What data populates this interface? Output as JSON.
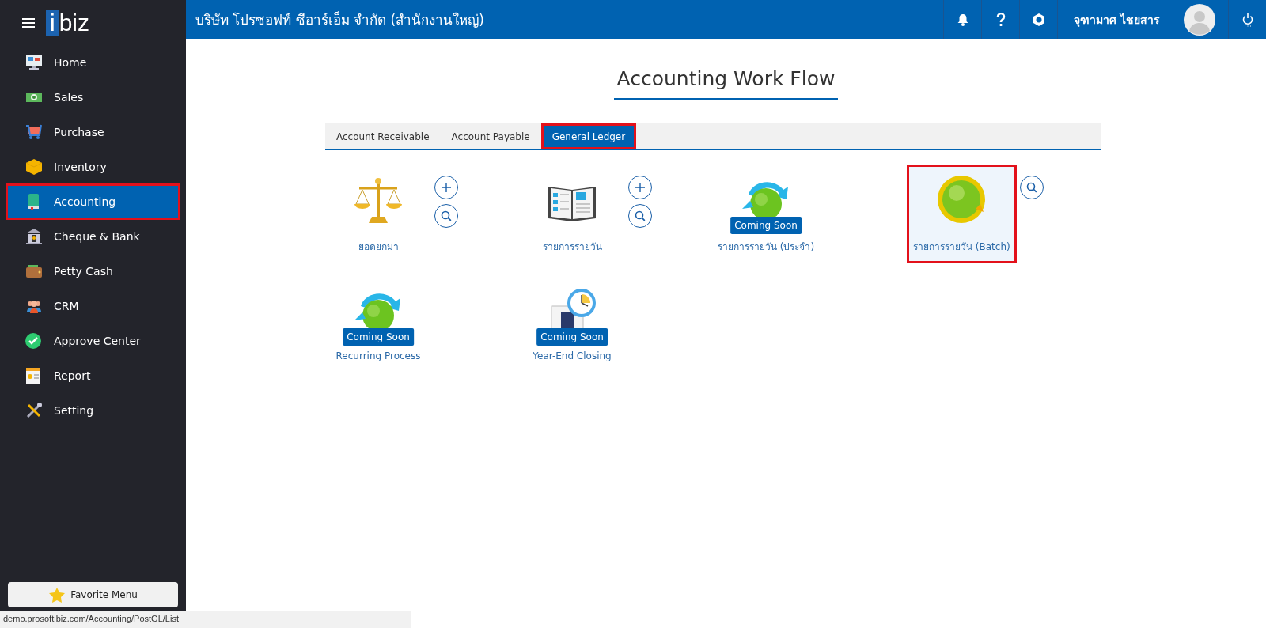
{
  "topbar": {
    "company": "บริษัท โปรซอฟท์ ซีอาร์เอ็ม จำกัด (สำนักงานใหญ่)",
    "user_name": "จุฑามาศ ไชยสาร"
  },
  "sidebar": {
    "logo_prefix": "i",
    "logo_rest": "biz",
    "items": [
      {
        "label": "Home",
        "selected": false,
        "highlighted": false
      },
      {
        "label": "Sales",
        "selected": false,
        "highlighted": false
      },
      {
        "label": "Purchase",
        "selected": false,
        "highlighted": false
      },
      {
        "label": "Inventory",
        "selected": false,
        "highlighted": false
      },
      {
        "label": "Accounting",
        "selected": true,
        "highlighted": true
      },
      {
        "label": "Cheque & Bank",
        "selected": false,
        "highlighted": false
      },
      {
        "label": "Petty Cash",
        "selected": false,
        "highlighted": false
      },
      {
        "label": "CRM",
        "selected": false,
        "highlighted": false
      },
      {
        "label": "Approve Center",
        "selected": false,
        "highlighted": false
      },
      {
        "label": "Report",
        "selected": false,
        "highlighted": false
      },
      {
        "label": "Setting",
        "selected": false,
        "highlighted": false
      }
    ],
    "favorite_button": "Favorite Menu"
  },
  "page": {
    "title": "Accounting Work Flow"
  },
  "tabs": [
    {
      "label": "Account Receivable",
      "selected": false,
      "highlighted": false
    },
    {
      "label": "Account Payable",
      "selected": false,
      "highlighted": false
    },
    {
      "label": "General Ledger",
      "selected": true,
      "highlighted": true
    }
  ],
  "workflow_items": [
    {
      "label": "ยอดยกมา",
      "coming_soon": false,
      "add_button": true,
      "search_button": true,
      "highlighted": false
    },
    {
      "label": "รายการรายวัน",
      "coming_soon": false,
      "add_button": true,
      "search_button": true,
      "highlighted": false
    },
    {
      "label": "รายการรายวัน (ประจำ)",
      "badge": "Coming Soon",
      "coming_soon": true,
      "add_button": false,
      "search_button": false,
      "highlighted": false
    },
    {
      "label": "รายการรายวัน (Batch)",
      "coming_soon": false,
      "add_button": false,
      "search_button": true,
      "highlighted": true
    },
    {
      "label": "Recurring Process",
      "badge": "Coming Soon",
      "coming_soon": true,
      "add_button": false,
      "search_button": false,
      "highlighted": false
    },
    {
      "label": "Year-End Closing",
      "badge": "Coming Soon",
      "coming_soon": true,
      "add_button": false,
      "search_button": false,
      "highlighted": false
    }
  ],
  "status_bar": {
    "url": "demo.prosoftibiz.com/Accounting/PostGL/List"
  }
}
